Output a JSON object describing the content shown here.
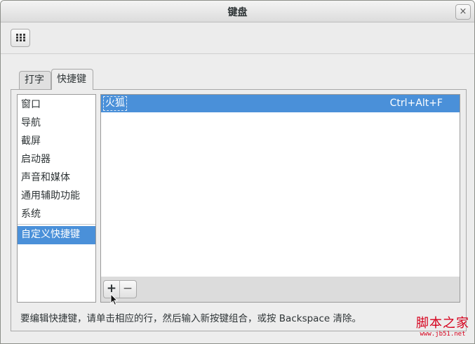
{
  "window": {
    "title": "键盘",
    "close_glyph": "×"
  },
  "toolbar": {
    "grid_button_icon": "grid-icon"
  },
  "tabs": [
    {
      "label": "打字"
    },
    {
      "label": "快捷键"
    }
  ],
  "categories": [
    {
      "label": "窗口"
    },
    {
      "label": "导航"
    },
    {
      "label": "截屏"
    },
    {
      "label": "启动器"
    },
    {
      "label": "声音和媒体"
    },
    {
      "label": "通用辅助功能"
    },
    {
      "label": "系统"
    },
    {
      "label": "自定义快捷键"
    }
  ],
  "shortcuts": [
    {
      "name": "火狐",
      "accel": "Ctrl+Alt+F"
    }
  ],
  "shortcut_buttons": {
    "add": "+",
    "remove": "−"
  },
  "hint": "要编辑快捷键，请单击相应的行，然后输入新按键组合，或按 Backspace 清除。",
  "watermark": {
    "main": "脚本之家",
    "sub": "www.jb51.net"
  },
  "colors": {
    "selection": "#4a90d9",
    "watermark": "#d6001c"
  }
}
